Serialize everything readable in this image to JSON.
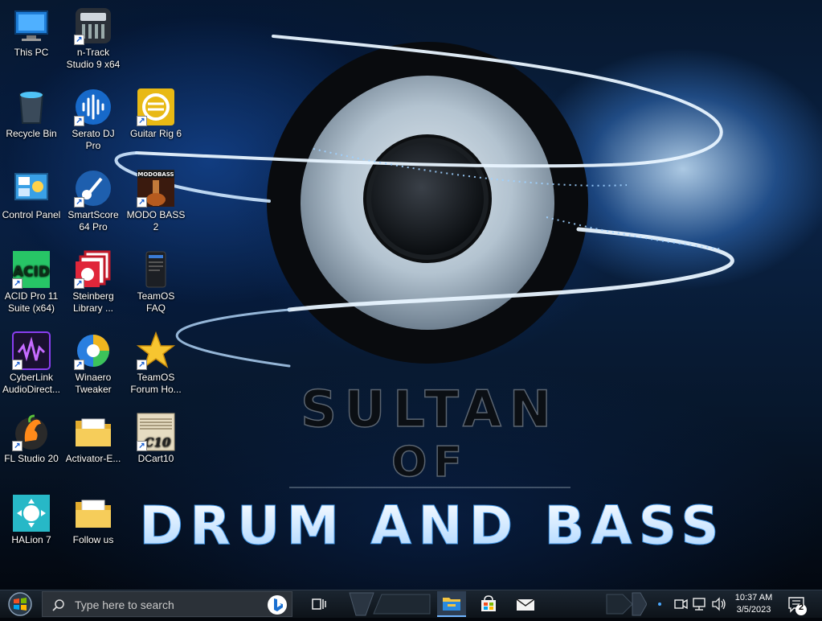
{
  "wallpaper": {
    "line1": "SULTAN",
    "line2": "OF",
    "line3": "DRUM AND BASS"
  },
  "desktop_icons": [
    {
      "label": "This PC",
      "icon": "this-pc-icon"
    },
    {
      "label": "n-Track Studio 9 x64",
      "icon": "ntrack-icon"
    },
    {
      "label": "Recycle Bin",
      "icon": "recycle-bin-icon"
    },
    {
      "label": "Serato DJ Pro",
      "icon": "serato-icon"
    },
    {
      "label": "Guitar Rig 6",
      "icon": "guitar-rig-icon"
    },
    {
      "label": "Control Panel",
      "icon": "control-panel-icon"
    },
    {
      "label": "SmartScore 64 Pro",
      "icon": "smartscore-icon"
    },
    {
      "label": "MODO BASS 2",
      "icon": "modo-bass-icon",
      "badge": "MODOBASS"
    },
    {
      "label": "ACID Pro 11 Suite (x64)",
      "icon": "acid-icon",
      "badge": "ACID"
    },
    {
      "label": "Steinberg Library ...",
      "icon": "steinberg-icon"
    },
    {
      "label": "TeamOS FAQ",
      "icon": "teamos-faq-icon"
    },
    {
      "label": "CyberLink AudioDirect...",
      "icon": "cyberlink-icon"
    },
    {
      "label": "Winaero Tweaker",
      "icon": "winaero-icon"
    },
    {
      "label": "TeamOS Forum Ho...",
      "icon": "star-icon"
    },
    {
      "label": "FL Studio 20",
      "icon": "fl-studio-icon"
    },
    {
      "label": "Activator-E...",
      "icon": "folder-icon"
    },
    {
      "label": "DCart10",
      "icon": "dcart-icon",
      "badge": "C10"
    },
    {
      "label": "HALion 7",
      "icon": "halion-icon"
    },
    {
      "label": "Follow us",
      "icon": "folder-icon"
    }
  ],
  "taskbar": {
    "search_placeholder": "Type here to search",
    "pinned": [
      "file-explorer-icon",
      "store-icon",
      "mail-icon"
    ],
    "clock_time": "10:37 AM",
    "clock_date": "3/5/2023",
    "notification_count": "2"
  },
  "colors": {
    "accent": "#1a6fd0",
    "taskbar": "#121a22"
  }
}
